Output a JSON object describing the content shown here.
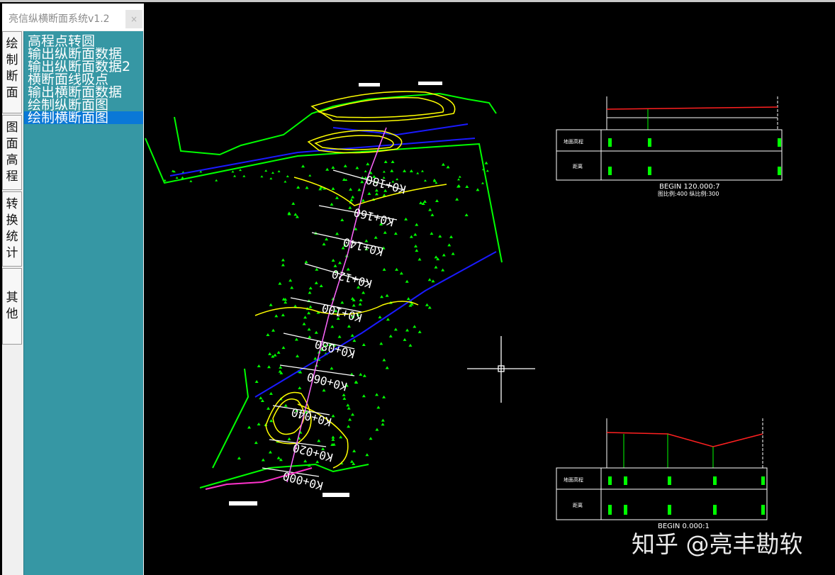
{
  "window": {
    "title": "亮信纵横断面系统v1.2",
    "close_label": "×"
  },
  "tabs": [
    {
      "label": "绘制断面",
      "chars": [
        "绘",
        "制",
        "断",
        "面"
      ]
    },
    {
      "label": "图面高程",
      "chars": [
        "图",
        "面",
        "高",
        "程"
      ]
    },
    {
      "label": "转换统计",
      "chars": [
        "转",
        "换",
        "统",
        "计"
      ]
    },
    {
      "label": "其他",
      "chars": [
        "其",
        "他"
      ]
    }
  ],
  "menu": {
    "items": [
      "高程点转圆",
      "输出纵断面数据",
      "输出纵断面数据2",
      "横断面线吸点",
      "输出横断面数据",
      "绘制纵断面图",
      "绘制横断面图"
    ],
    "selected_index": 6
  },
  "drawing": {
    "stations": [
      "K0+180",
      "K0+160",
      "K0+140",
      "K0+120",
      "K0+100",
      "K0+080",
      "K0+060",
      "K0+040",
      "K0+020",
      "K0+000"
    ],
    "top_section": {
      "caption": "BEGIN 120.000:7",
      "scale": "图比例:400 纵比例:300",
      "row1": "地面高程",
      "row2": "距离"
    },
    "bottom_section": {
      "caption": "BEGIN 0.000:1",
      "row1": "地面高程",
      "row2": "距离"
    },
    "colors": {
      "ground": "#00ff00",
      "contour": "#ffff00",
      "centerline": "#ff66ff",
      "road": "#0000ff",
      "design": "#ff0000"
    }
  },
  "watermark": "知乎 @亮丰勘软"
}
